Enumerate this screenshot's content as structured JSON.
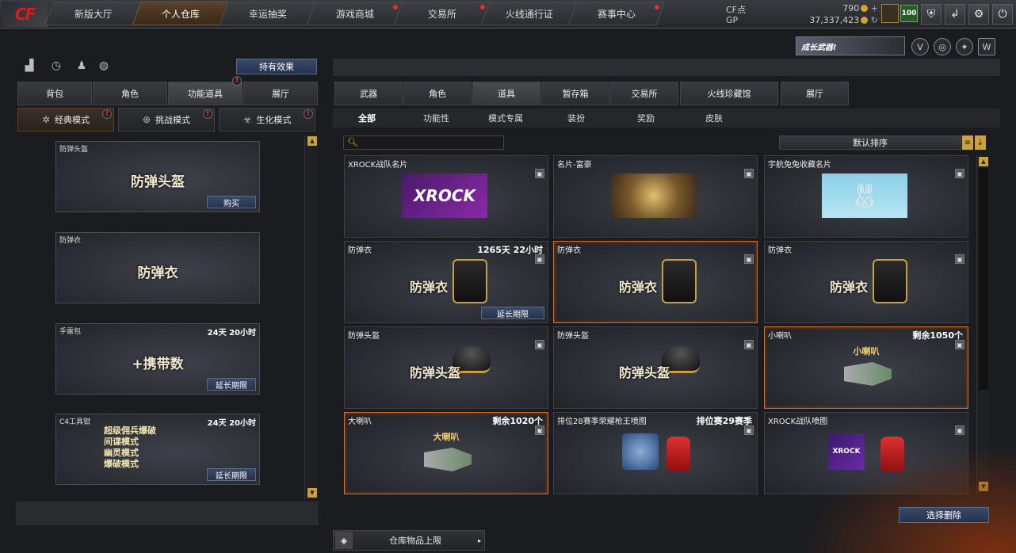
{
  "logo": "CF",
  "nav": [
    {
      "label": "新版大厅",
      "active": false,
      "dot": false
    },
    {
      "label": "个人仓库",
      "active": true,
      "dot": false
    },
    {
      "label": "幸运抽奖",
      "active": false,
      "dot": false
    },
    {
      "label": "游戏商城",
      "active": false,
      "dot": true
    },
    {
      "label": "交易所",
      "active": false,
      "dot": true
    },
    {
      "label": "火线通行证",
      "active": false,
      "dot": false
    },
    {
      "label": "赛事中心",
      "active": false,
      "dot": true
    }
  ],
  "currency": {
    "cf_label": "CF点",
    "cf_value": "790",
    "gp_label": "GP",
    "gp_value": "37,337,423"
  },
  "level": "100",
  "banner": "成长武器!",
  "left": {
    "effect_button": "持有效果",
    "tabs": [
      {
        "label": "背包",
        "active": false
      },
      {
        "label": "角色",
        "active": false
      },
      {
        "label": "功能道具",
        "active": true
      },
      {
        "label": "展厅",
        "active": false
      }
    ],
    "modes": [
      {
        "label": "经典模式",
        "active": true
      },
      {
        "label": "挑战模式",
        "active": false
      },
      {
        "label": "生化模式",
        "active": false
      }
    ],
    "items": [
      {
        "name": "防弹头盔",
        "time": "",
        "big": "防弹头盔",
        "button": "购买"
      },
      {
        "name": "防弹衣",
        "time": "",
        "big": "防弹衣",
        "button": ""
      },
      {
        "name": "手雷包",
        "time": "24天 20小时",
        "big": "+携带数",
        "button": "延长期限"
      },
      {
        "name": "C4工具钳",
        "time": "24天 20小时",
        "big": "",
        "button": "延长期限",
        "modes": [
          "超级佣兵爆破",
          "间谍模式",
          "幽灵模式",
          "爆破模式"
        ]
      }
    ]
  },
  "right": {
    "tabs": [
      {
        "label": "武器",
        "active": false
      },
      {
        "label": "角色",
        "active": false
      },
      {
        "label": "道具",
        "active": true
      },
      {
        "label": "暂存箱",
        "active": false
      },
      {
        "label": "交易所",
        "active": false
      },
      {
        "label": "火线珍藏馆",
        "active": false
      },
      {
        "label": "展厅",
        "active": false
      }
    ],
    "subtabs": [
      {
        "label": "全部",
        "active": true
      },
      {
        "label": "功能性",
        "active": false
      },
      {
        "label": "模式专属",
        "active": false
      },
      {
        "label": "装扮",
        "active": false
      },
      {
        "label": "奖励",
        "active": false
      },
      {
        "label": "皮肤",
        "active": false
      }
    ],
    "search_placeholder": "",
    "sort_label": "默认排序",
    "items": [
      {
        "name": "XROCK战队名片",
        "time": "",
        "big": "",
        "small": "",
        "button": "",
        "pic": "xrock",
        "highlight": false
      },
      {
        "name": "名片-富豪",
        "time": "",
        "big": "",
        "small": "",
        "button": "",
        "pic": "dragon",
        "highlight": false
      },
      {
        "name": "宇航兔兔收藏名片",
        "time": "",
        "big": "",
        "small": "",
        "button": "",
        "pic": "bunny",
        "highlight": false
      },
      {
        "name": "防弹衣",
        "time": "1265天 22小时",
        "big": "防弹衣",
        "small": "",
        "button": "延长期限",
        "pic": "vest",
        "highlight": false
      },
      {
        "name": "防弹衣",
        "time": "",
        "big": "防弹衣",
        "small": "",
        "button": "",
        "pic": "vest",
        "highlight": true
      },
      {
        "name": "防弹衣",
        "time": "",
        "big": "防弹衣",
        "small": "",
        "button": "",
        "pic": "vest",
        "highlight": false
      },
      {
        "name": "防弹头盔",
        "time": "",
        "big": "防弹头盔",
        "small": "",
        "button": "",
        "pic": "helmet",
        "highlight": false
      },
      {
        "name": "防弹头盔",
        "time": "",
        "big": "防弹头盔",
        "small": "",
        "button": "",
        "pic": "helmet",
        "highlight": false
      },
      {
        "name": "小喇叭",
        "time": "剩余1050个",
        "big": "",
        "small": "小喇叭",
        "button": "",
        "pic": "horn",
        "highlight": true
      },
      {
        "name": "大喇叭",
        "time": "剩余1020个",
        "big": "",
        "small": "大喇叭",
        "button": "",
        "pic": "horn",
        "highlight": true
      },
      {
        "name": "排位28赛季荣耀枪王喷图",
        "time": "排位赛29赛季",
        "big": "",
        "small": "",
        "button": "",
        "pic": "spray-rank",
        "highlight": false
      },
      {
        "name": "XROCK战队喷图",
        "time": "",
        "big": "",
        "small": "",
        "button": "",
        "pic": "spray-xrock",
        "highlight": false
      }
    ],
    "delete_button": "选择删除",
    "limit_label": "仓库物品上限"
  }
}
